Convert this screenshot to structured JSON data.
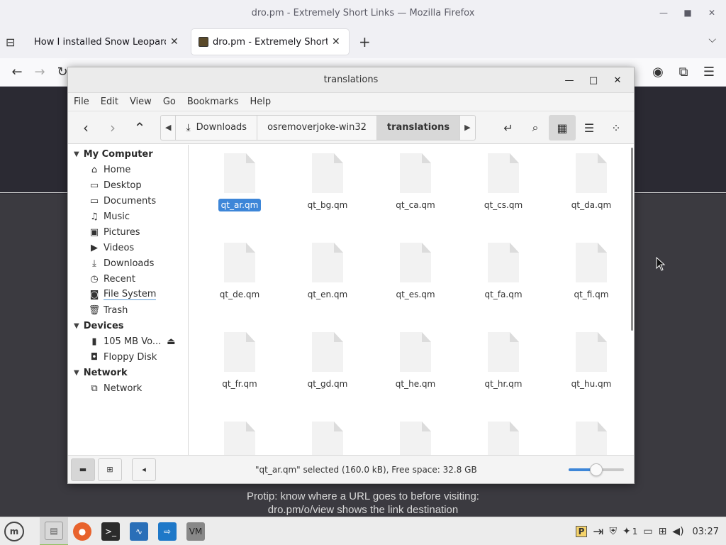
{
  "browser": {
    "window_title": "dro.pm - Extremely Short Links — Mozilla Firefox",
    "tabs": [
      {
        "label": "How I installed Snow Leopard v"
      },
      {
        "label": "dro.pm - Extremely Short Li"
      }
    ],
    "protip_line1": "Protip: know where a URL goes to before visiting:",
    "protip_line2": "dro.pm/o/view shows the link destination"
  },
  "file_manager": {
    "title": "translations",
    "menu": [
      "File",
      "Edit",
      "View",
      "Go",
      "Bookmarks",
      "Help"
    ],
    "path": [
      "Downloads",
      "osremoverjoke-win32",
      "translations"
    ],
    "sidebar": {
      "my_computer": {
        "heading": "My Computer",
        "items": [
          "Home",
          "Desktop",
          "Documents",
          "Music",
          "Pictures",
          "Videos",
          "Downloads",
          "Recent",
          "File System",
          "Trash"
        ]
      },
      "devices": {
        "heading": "Devices",
        "items": [
          "105 MB Vo...",
          "Floppy Disk"
        ]
      },
      "network": {
        "heading": "Network",
        "items": [
          "Network"
        ]
      }
    },
    "files": [
      "qt_ar.qm",
      "qt_bg.qm",
      "qt_ca.qm",
      "qt_cs.qm",
      "qt_da.qm",
      "qt_de.qm",
      "qt_en.qm",
      "qt_es.qm",
      "qt_fa.qm",
      "qt_fi.qm",
      "qt_fr.qm",
      "qt_gd.qm",
      "qt_he.qm",
      "qt_hr.qm",
      "qt_hu.qm"
    ],
    "selected_file": "qt_ar.qm",
    "status_text": "\"qt_ar.qm\" selected (160.0 kB), Free space: 32.8 GB",
    "zoom_level": 0.5
  },
  "taskbar": {
    "tray_count": "1",
    "clock": "03:27"
  }
}
